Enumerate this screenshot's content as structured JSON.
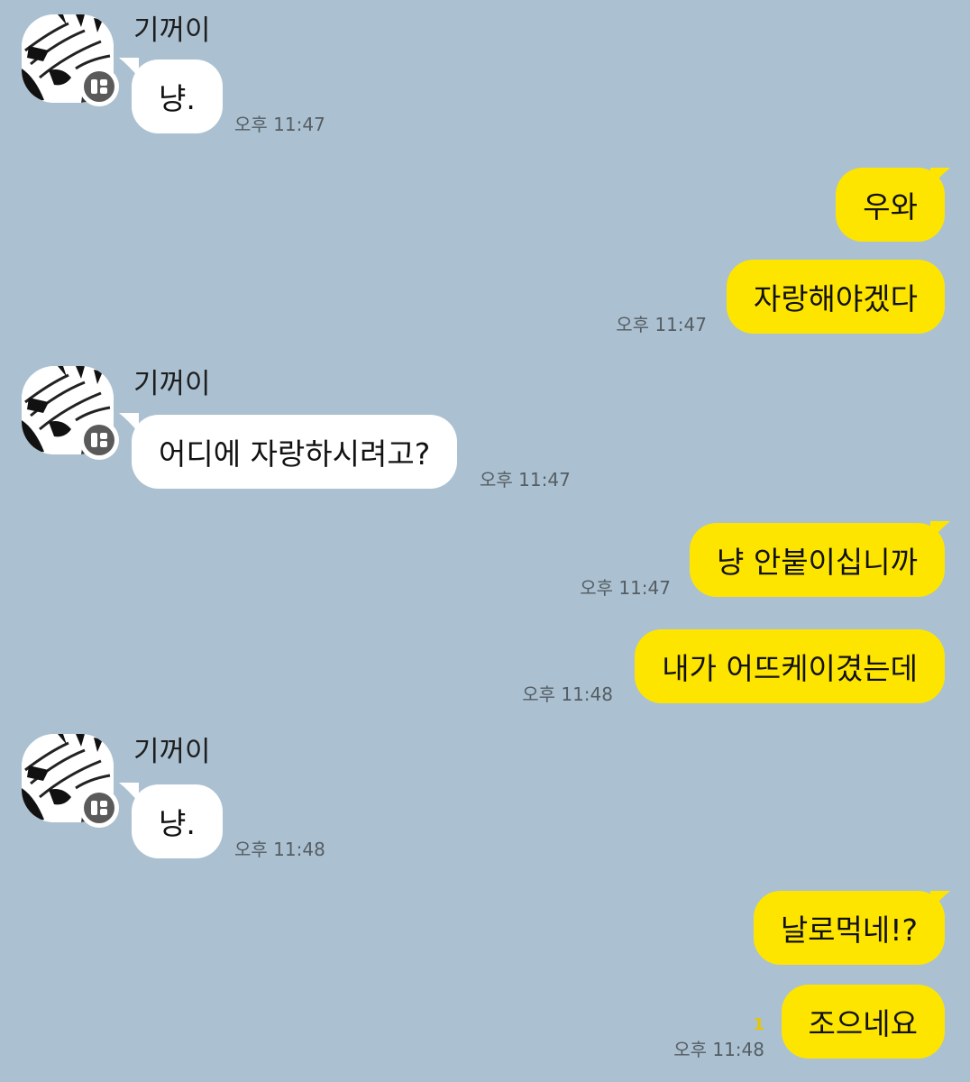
{
  "colors": {
    "background": "#abc1d1",
    "incoming_bubble": "#ffffff",
    "outgoing_bubble": "#fee500",
    "timestamp": "#555d63",
    "unread": "#e8c500"
  },
  "contact": {
    "name": "기꺼이",
    "avatar_icon": "manga-profile-avatar",
    "badge_icon": "chat-badge-icon"
  },
  "messages": [
    {
      "dir": "in",
      "text": "냥.",
      "time": "오후 11:47"
    },
    {
      "dir": "out",
      "text": "우와"
    },
    {
      "dir": "out",
      "text": "자랑해야겠다",
      "time": "오후 11:47"
    },
    {
      "dir": "in",
      "text": "어디에 자랑하시려고?",
      "time": "오후 11:47"
    },
    {
      "dir": "out",
      "text": "냥 안붙이십니까",
      "time": "오후 11:47"
    },
    {
      "dir": "out",
      "text": "내가 어뜨케이겼는데",
      "time": "오후 11:48"
    },
    {
      "dir": "in",
      "text": "냥.",
      "time": "오후 11:48"
    },
    {
      "dir": "out",
      "text": "날로먹네!?"
    },
    {
      "dir": "out",
      "text": "조으네요",
      "time": "오후 11:48",
      "unread": "1"
    }
  ]
}
